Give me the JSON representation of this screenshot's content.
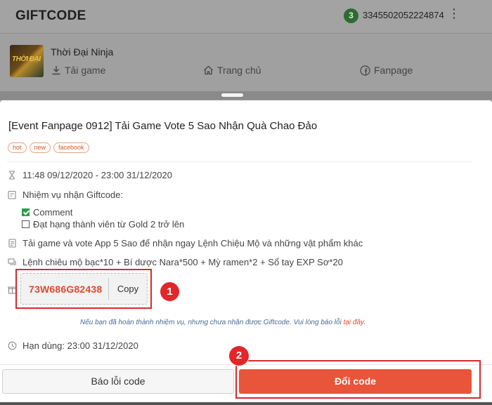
{
  "background": {
    "logo": "GIFTCODE",
    "badge_count": "3",
    "user_id": "3345502052224874",
    "game": {
      "title": "Thời Đại Ninja",
      "thumb_text": "THỜI ĐẠI",
      "nav": {
        "download": "Tải game",
        "home": "Trang chủ",
        "fanpage": "Fanpage"
      }
    }
  },
  "event": {
    "title": "[Event Fanpage 0912] Tải Game Vote 5 Sao Nhận Quà Chao Đảo",
    "tags": [
      "hot",
      "new",
      "facebook"
    ],
    "time_range": "11:48 09/12/2020 - 23:00 31/12/2020",
    "mission_heading": "Nhiệm vụ nhận Giftcode:",
    "missions": [
      {
        "label": "Comment",
        "done": true
      },
      {
        "label": "Đạt hạng thành viên từ Gold 2 trở lên",
        "done": false
      }
    ],
    "description": "Tải game và vote App 5 Sao để nhận ngay Lệnh Chiệu Mộ và những vật phẩm khác",
    "rewards": "Lệnh chiêu mộ bạc*10 + Bí dược Nara*500 + Mỳ ramen*2 + Sổ tay EXP Sơ*20",
    "code": "73W686G82438",
    "copy_label": "Copy",
    "note_text": "Nếu bạn đã hoàn thành nhiệm vụ, nhưng chưa nhận được Giftcode. Vui lòng báo lỗi ",
    "note_link": "tại đây",
    "note_end": ".",
    "expiry": "Hạn dùng: 23:00 31/12/2020"
  },
  "footer": {
    "report_label": "Báo lỗi code",
    "redeem_label": "Đổi code"
  },
  "annotations": {
    "marker_1": "1",
    "marker_2": "2"
  },
  "colors": {
    "accent": "#e8553a",
    "code": "#e0482d",
    "highlight": "#d9292b",
    "success": "#2e9b4a"
  }
}
